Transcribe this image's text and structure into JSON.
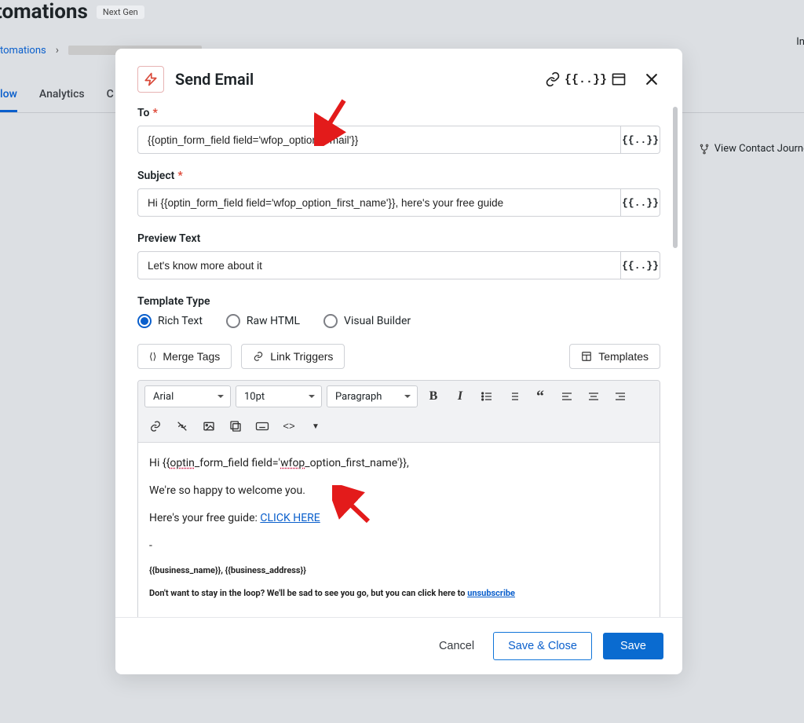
{
  "bg": {
    "title": "tomations",
    "badge": "Next Gen",
    "breadcrumb": "tomations",
    "status": "Ina",
    "tabs": {
      "flow": "low",
      "analytics": "Analytics",
      "other": "C"
    },
    "journey": "View Contact Journe"
  },
  "modal": {
    "title": "Send Email",
    "to": {
      "label": "To",
      "value": "{{optin_form_field field='wfop_option_email'}}"
    },
    "subject": {
      "label": "Subject",
      "value": "Hi {{optin_form_field field='wfop_option_first_name'}}, here's your free guide"
    },
    "preview": {
      "label": "Preview Text",
      "value": "Let's know more about it"
    },
    "templateType": {
      "label": "Template Type",
      "options": {
        "rich": "Rich Text",
        "raw": "Raw HTML",
        "visual": "Visual Builder"
      }
    },
    "buttons": {
      "mergeTags": "Merge Tags",
      "linkTriggers": "Link Triggers",
      "templates": "Templates"
    },
    "editor": {
      "font": "Arial",
      "size": "10pt",
      "block": "Paragraph",
      "body": {
        "p1_a": "Hi {{",
        "p1_b": "optin",
        "p1_c": "_form_field field='",
        "p1_d": "wfop",
        "p1_e": "_option_first_name'}},",
        "p2": "We're so happy to welcome you.",
        "p3a": "Here's your free guide: ",
        "p3link": "CLICK HERE",
        "p4": "-",
        "f1": "{{business_name}}, {{business_address}}",
        "f2a": "Don't want to stay in the loop? We'll be sad to see you go, but you can click here to ",
        "f2b": "unsubscribe"
      }
    },
    "addon": "{{..}}",
    "footer": {
      "cancel": "Cancel",
      "saveClose": "Save & Close",
      "save": "Save"
    }
  }
}
